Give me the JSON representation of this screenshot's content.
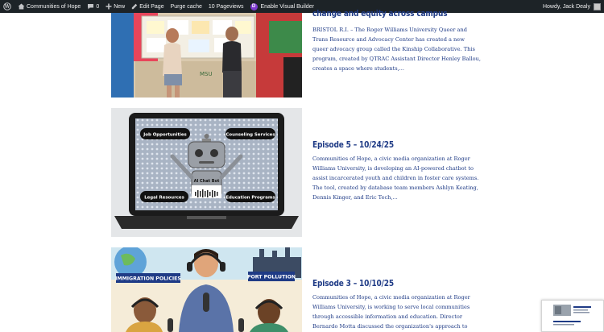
{
  "adminbar": {
    "site_name": "Communities of Hope",
    "comments_count": "0",
    "new_label": "New",
    "edit_label": "Edit Page",
    "purge_label": "Purge cache",
    "pageviews_label": "10 Pageviews",
    "visual_builder_label": "Enable Visual Builder",
    "howdy_label": "Howdy, Jack Dealy"
  },
  "posts": [
    {
      "title": "change and equity across campus",
      "excerpt": "BRISTOL R.I. – The Roger Williams University Queer and Trans Resource and Advocacy Center has created a new queer advocacy group called the Kinship Collaborative. This program, created by QTRAC Assistant Director Henley Ballou, creates a space where students,..."
    },
    {
      "title": "Episode 5 – 10/24/25",
      "excerpt": "Communities of Hope, a civic media organization at Roger Williams University, is developing an AI-powered chatbot to assist incarcerated youth and children in foster care systems. The tool, created by database team members Ashlyn Keating, Dennis Kinger, and Eric Tech,...",
      "image_labels": {
        "top_left": "Job Opportunities",
        "top_right": "Counseling Services",
        "bottom_left": "Legal Resources",
        "bottom_right": "Education Programs",
        "center": "AI Chat Bot"
      }
    },
    {
      "title": "Episode 3 – 10/10/25",
      "excerpt": "Communities of Hope, a civic media organization at Roger Williams University, is working to serve local communities through accessible information and education. Director Bernardo Motta discussed the organization's approach to community-centered",
      "image_labels": {
        "left": "IMMIGRATION POLICIES",
        "right": "PORT POLLUTION"
      }
    }
  ]
}
